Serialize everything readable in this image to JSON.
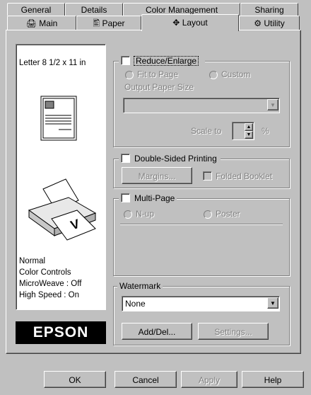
{
  "tabs_back": [
    "General",
    "Details",
    "Color Management",
    "Sharing"
  ],
  "tabs_front": [
    "Main",
    "Paper",
    "Layout",
    "Utility"
  ],
  "preview": {
    "paper_size": "Letter 8 1/2 x 11 in",
    "status": [
      "Normal",
      "Color Controls",
      "MicroWeave : Off",
      "High Speed : On"
    ],
    "logo": "EPSON"
  },
  "reduce": {
    "label": "Reduce/Enlarge",
    "fit": "Fit to Page",
    "custom": "Custom",
    "output_label": "Output Paper Size",
    "scale_label": "Scale to",
    "scale_unit": "%"
  },
  "duplex": {
    "label": "Double-Sided Printing",
    "margins": "Margins...",
    "booklet": "Folded Booklet"
  },
  "multipage": {
    "label": "Multi-Page",
    "nup": "N-up",
    "poster": "Poster"
  },
  "watermark": {
    "label": "Watermark",
    "value": "None",
    "add": "Add/Del...",
    "settings": "Settings..."
  },
  "buttons": {
    "ok": "OK",
    "cancel": "Cancel",
    "apply": "Apply",
    "help": "Help"
  }
}
